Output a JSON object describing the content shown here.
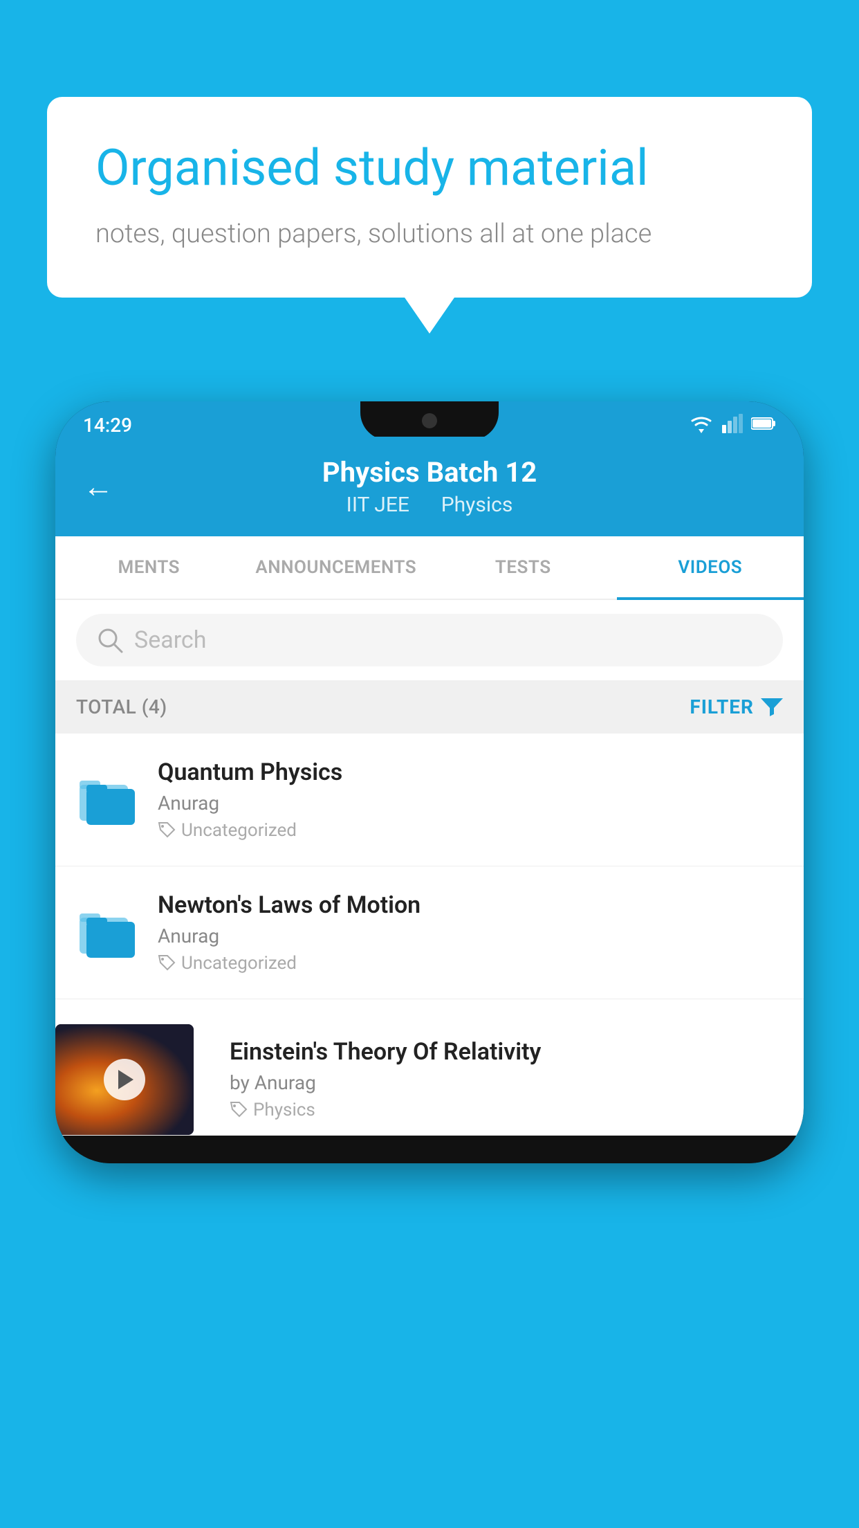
{
  "background_color": "#18B4E8",
  "speech_bubble": {
    "title": "Organised study material",
    "subtitle": "notes, question papers, solutions all at one place"
  },
  "status_bar": {
    "time": "14:29",
    "wifi": "▾",
    "signal": "▴",
    "battery": "▮"
  },
  "app_header": {
    "back_label": "←",
    "title": "Physics Batch 12",
    "subtitle_part1": "IIT JEE",
    "subtitle_part2": "Physics"
  },
  "tabs": [
    {
      "label": "MENTS",
      "active": false
    },
    {
      "label": "ANNOUNCEMENTS",
      "active": false
    },
    {
      "label": "TESTS",
      "active": false
    },
    {
      "label": "VIDEOS",
      "active": true
    }
  ],
  "search": {
    "placeholder": "Search"
  },
  "filter_bar": {
    "total_label": "TOTAL (4)",
    "filter_label": "FILTER"
  },
  "list_items": [
    {
      "title": "Quantum Physics",
      "author": "Anurag",
      "tag": "Uncategorized",
      "type": "folder"
    },
    {
      "title": "Newton's Laws of Motion",
      "author": "Anurag",
      "tag": "Uncategorized",
      "type": "folder"
    },
    {
      "title": "Einstein's Theory Of Relativity",
      "author": "by Anurag",
      "tag": "Physics",
      "type": "video"
    }
  ]
}
